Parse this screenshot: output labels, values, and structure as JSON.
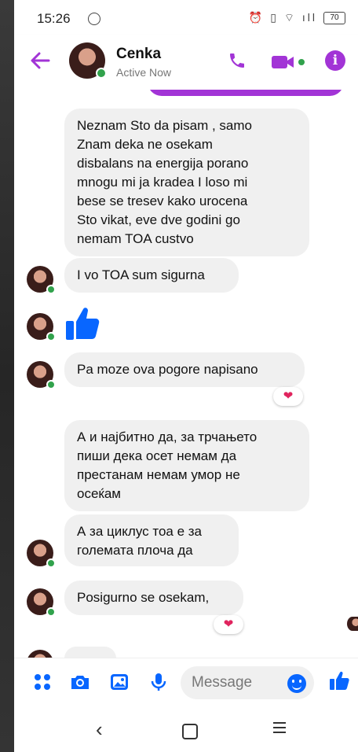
{
  "status_bar": {
    "time": "15:26",
    "battery": "70"
  },
  "header": {
    "contact_name": "Cenka",
    "presence": "Active Now",
    "accent_color": "#a234d6"
  },
  "messages": [
    {
      "text": "Neznam Sto da pisam , samo\nZnam deka ne osekam\ndisbalans na energija porano\nmnogu mi ja kradea I loso mi\nbese se tresev kako urocena\nSto vikat, eve dve godini go\nnemam TOA custvo"
    },
    {
      "text": "I vo TOA sum sigurna"
    },
    {
      "text": "Pa moze ova pogore  napisano",
      "reaction": "heart"
    },
    {
      "text": "А и  најбитно да, за трчањето\nпиши дека осет немам да\nпрестанам немам умор не\nосеќам"
    },
    {
      "text": "А  за циклус тоа е за\nголемата плоча да"
    },
    {
      "text": "Posigurno se osekam,",
      "reaction": "heart"
    }
  ],
  "composer": {
    "placeholder": "Message",
    "icons": [
      "apps-icon",
      "camera-icon",
      "gallery-icon",
      "microphone-icon",
      "emoji-icon",
      "thumbs-up-icon"
    ]
  },
  "reaction_glyph": "❤"
}
